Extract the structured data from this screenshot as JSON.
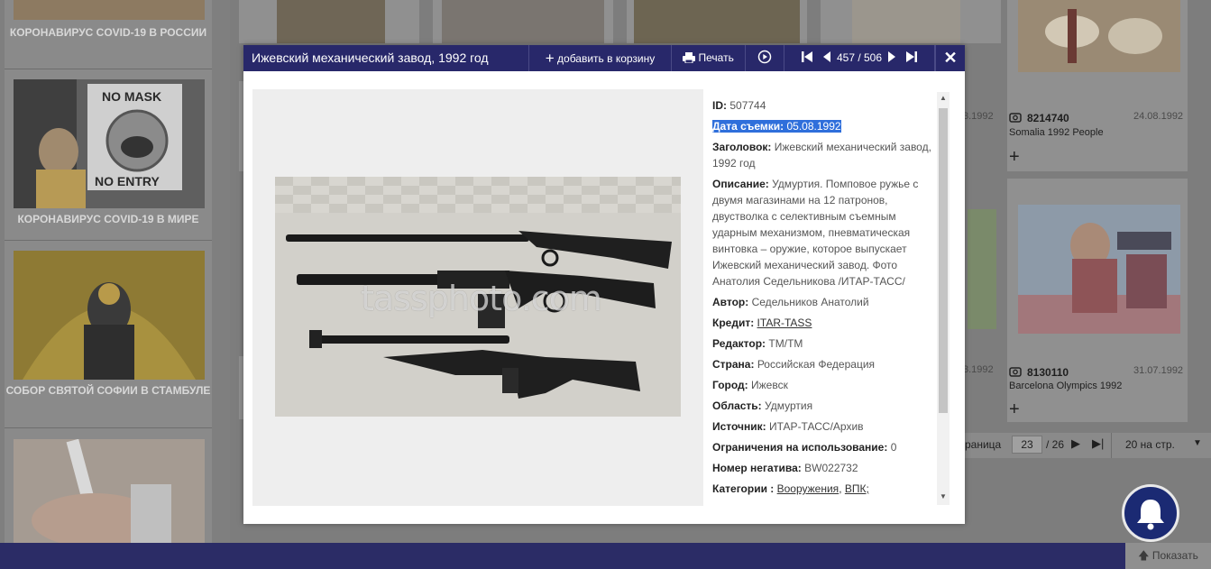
{
  "sidebar": {
    "items": [
      {
        "label": "КОРОНАВИРУС COVID-19 В РОССИИ"
      },
      {
        "label": "КОРОНАВИРУС COVID-19 В МИРЕ",
        "sign_text": "NO MASK\nNO ENTRY"
      },
      {
        "label": "СОБОР СВЯТОЙ СОФИИ В СТАМБУЛЕ"
      },
      {
        "label": ""
      }
    ]
  },
  "grid": {
    "tiles": [
      {
        "id": "8214740",
        "caption": "Somalia 1992 People",
        "date": "24.08.1992"
      },
      {
        "id": "8130110",
        "caption": "Barcelona Olympics 1992",
        "date": "31.07.1992"
      }
    ],
    "partial_dates": [
      "3.1992",
      "3.1992"
    ]
  },
  "pagination": {
    "label": "раница",
    "current": "23",
    "total": "/ 26",
    "per_page": "20 на стр."
  },
  "bottom": {
    "show_label": "Показать"
  },
  "modal": {
    "title": "Ижевский механический завод, 1992 год",
    "add_to_cart": "добавить в корзину",
    "print": "Печать",
    "counter": "457 / 506",
    "watermark": "tassphoto.com",
    "fields": [
      {
        "label": "ID:",
        "value": "507744"
      },
      {
        "label": "Дата съемки:",
        "value": "05.08.1992",
        "selected": true
      },
      {
        "label": "Заголовок:",
        "value": "Ижевский механический завод, 1992 год"
      },
      {
        "label": "Описание:",
        "value": "Удмуртия. Помповое ружье с двумя магазинами на 12 патронов, двустволка с селективным съемным ударным механизмом, пневматическая винтовка – оружие, которое выпускает Ижевский механический завод. Фото Анатолия Седельникова /ИТАР-ТАСС/"
      },
      {
        "label": "Автор:",
        "value": "Седельников Анатолий"
      },
      {
        "label": "Кредит:",
        "link": "ITAR-TASS"
      },
      {
        "label": "Редактор:",
        "value": "ТМ/ТМ"
      },
      {
        "label": "Страна:",
        "value": "Российская Федерация"
      },
      {
        "label": "Город:",
        "value": "Ижевск"
      },
      {
        "label": "Область:",
        "value": "Удмуртия"
      },
      {
        "label": "Источник:",
        "value": "ИТАР-ТАСС/Архив"
      },
      {
        "label": "Ограничения на использование:",
        "value": "0"
      },
      {
        "label": "Номер негатива:",
        "value": "BW022732"
      },
      {
        "label": "Категории :",
        "links": [
          "Вооружения",
          "ВПК;"
        ]
      }
    ]
  },
  "colors": {
    "header_bg": "#28286a",
    "selection": "#2f6fdb",
    "bottom_bar": "#2b2c66"
  }
}
